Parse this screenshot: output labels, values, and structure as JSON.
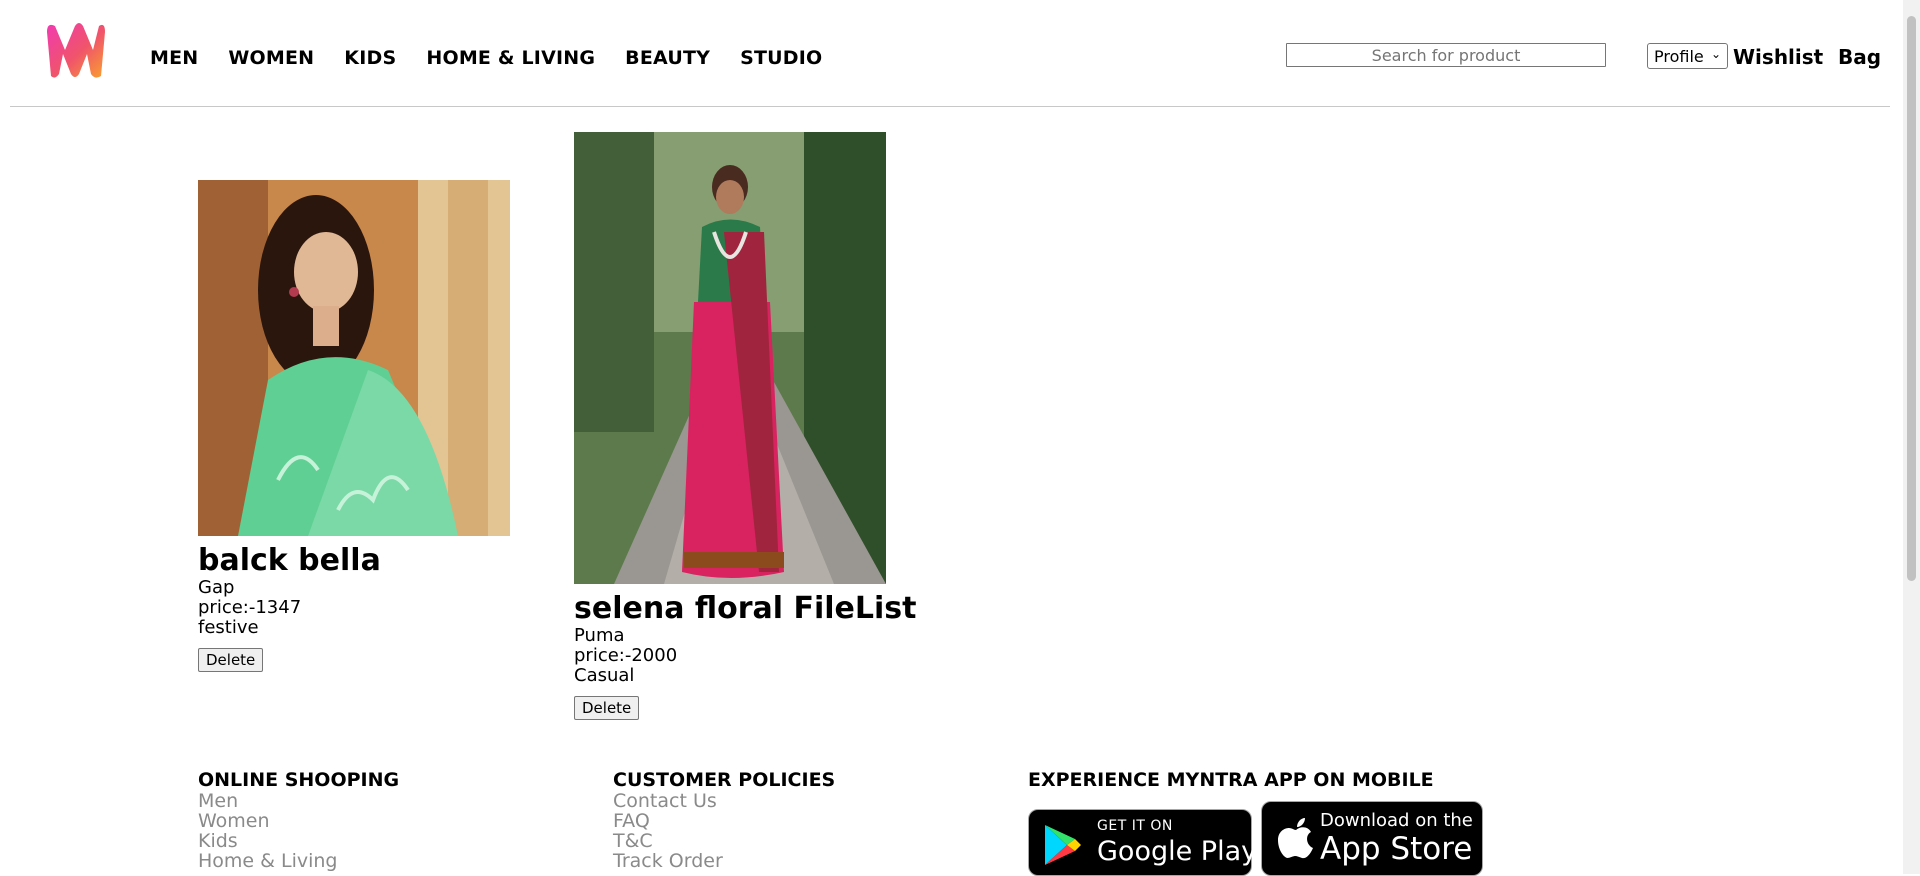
{
  "header": {
    "nav": [
      "MEN",
      "WOMEN",
      "KIDS",
      "HOME & LIVING",
      "BEAUTY",
      "STUDIO"
    ],
    "search_placeholder": "Search for product",
    "profile_label": "Profile",
    "wishlist_label": "Wishlist",
    "bag_label": "Bag"
  },
  "products": [
    {
      "title": "balck bella",
      "brand": "Gap",
      "price": "price:-1347",
      "category": "festive",
      "delete_label": "Delete"
    },
    {
      "title": "selena floral FileList",
      "brand": "Puma",
      "price": "price:-2000",
      "category": "Casual",
      "delete_label": "Delete"
    }
  ],
  "footer": {
    "online_shopping": {
      "heading": "ONLINE SHOOPING",
      "links": [
        "Men",
        "Women",
        "Kids",
        "Home & Living"
      ]
    },
    "customer_policies": {
      "heading": "CUSTOMER POLICIES",
      "links": [
        "Contact Us",
        "FAQ",
        "T&C",
        "Track Order"
      ]
    },
    "app": {
      "heading": "EXPERIENCE MYNTRA APP ON MOBILE",
      "google_small": "GET IT ON",
      "google_big": "Google Play",
      "apple_small": "Download on the",
      "apple_big": "App Store"
    }
  },
  "colors": {
    "logo_pink": "#e3368f",
    "logo_orange": "#f36b2f",
    "link_gray": "#8a8a8a"
  }
}
